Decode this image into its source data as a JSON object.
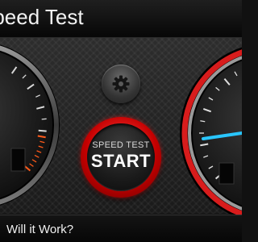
{
  "header": {
    "title": "Speed Test"
  },
  "speed_test_button": {
    "top_label": "SPEED TEST",
    "main_label": "START"
  },
  "footer": {
    "text": "Will it Work?"
  },
  "colors": {
    "accent_red": "#e21b1b",
    "needle_blue": "#29c6ff",
    "tick_orange": "#ff5a1a",
    "background": "#111111"
  },
  "icons": {
    "settings": "gear-icon"
  }
}
